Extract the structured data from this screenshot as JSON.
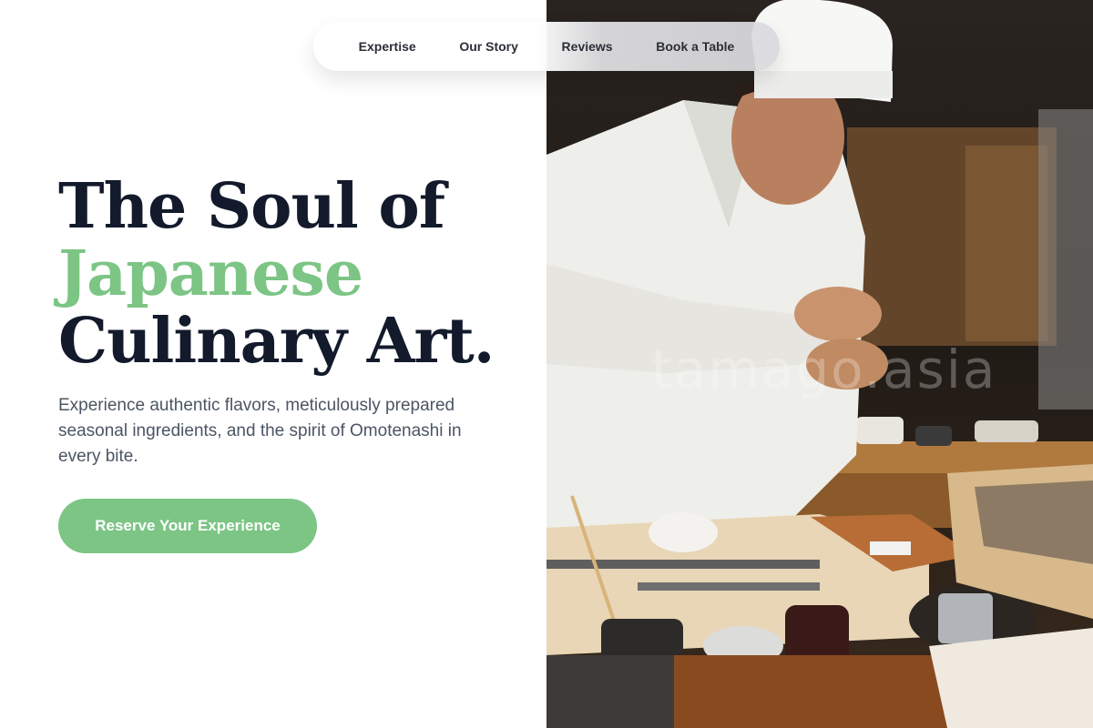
{
  "nav": {
    "items": [
      {
        "label": "Expertise"
      },
      {
        "label": "Our Story"
      },
      {
        "label": "Reviews"
      },
      {
        "label": "Book a Table"
      }
    ]
  },
  "hero": {
    "title_line1": "The Soul of",
    "title_accent": "Japanese",
    "title_line3": "Culinary Art.",
    "subtitle": "Experience authentic flavors, meticulously prepared seasonal ingredients, and the spirit of Omotenashi in every bite.",
    "cta_label": "Reserve Your Experience"
  },
  "photo": {
    "watermark": "tamago.asia",
    "subject": "sushi chef preparing nigiri at counter"
  },
  "colors": {
    "accent": "#7cc585",
    "heading": "#121a2b",
    "body_text": "#4b5563",
    "background": "#ffffff"
  }
}
